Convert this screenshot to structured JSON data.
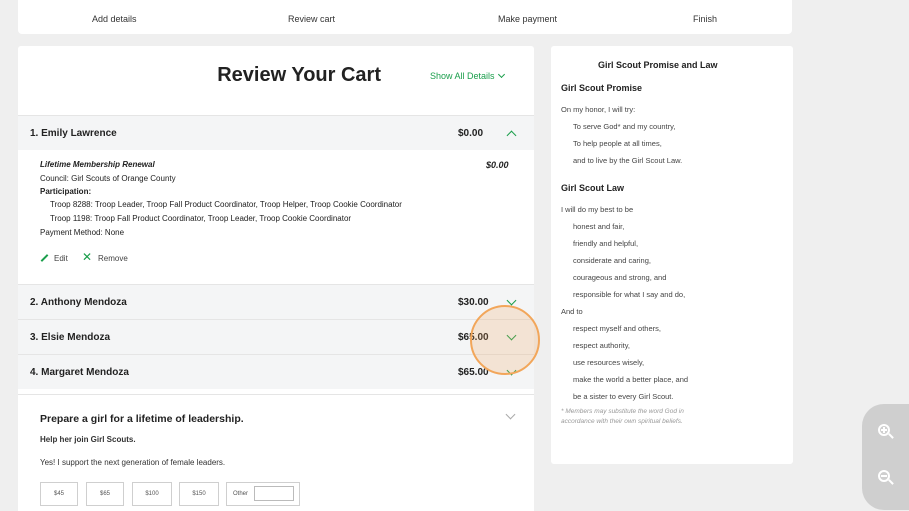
{
  "steps": [
    "Add details",
    "Review cart",
    "Make payment",
    "Finish"
  ],
  "cart": {
    "title": "Review Your Cart",
    "show_all": "Show All Details",
    "members": [
      {
        "name": "1. Emily Lawrence",
        "amount": "$0.00"
      },
      {
        "name": "2. Anthony Mendoza",
        "amount": "$30.00"
      },
      {
        "name": "3. Elsie Mendoza",
        "amount": "$65.00"
      },
      {
        "name": "4. Margaret Mendoza",
        "amount": "$65.00"
      }
    ],
    "detail": {
      "item": "Lifetime Membership Renewal",
      "item_amount": "$0.00",
      "council": "Council: Girl Scouts of Orange County",
      "participation_label": "Participation:",
      "troops": [
        "Troop 8288: Troop Leader, Troop Fall Product Coordinator, Troop Helper, Troop Cookie Coordinator",
        "Troop 1198: Troop Fall Product Coordinator, Troop Leader, Troop Cookie Coordinator"
      ],
      "payment_method": "Payment Method: None",
      "edit": "Edit",
      "remove": "Remove"
    },
    "donate": {
      "heading": "Prepare a girl for a lifetime of leadership.",
      "sub": "Help her join Girl Scouts.",
      "yes": "Yes! I support the next generation of female leaders.",
      "amounts": [
        "$45",
        "$65",
        "$100",
        "$150"
      ],
      "other": "Other"
    }
  },
  "promise": {
    "title": "Girl Scout Promise and Law",
    "promise_heading": "Girl Scout Promise",
    "promise_lines": [
      "On my honor, I will try:",
      "To serve God* and my country,",
      "To help people at all times,",
      "and to live by the Girl Scout Law."
    ],
    "law_heading": "Girl Scout Law",
    "law_lines": [
      "I will do my best to be",
      "honest and fair,",
      "friendly and helpful,",
      "considerate and caring,",
      "courageous and strong, and",
      "responsible for what I say and do,",
      "And to",
      "respect myself and others,",
      "respect authority,",
      "use resources wisely,",
      "make the world a better place, and",
      "be a sister to every Girl Scout."
    ],
    "note_lines": [
      "* Members may substitute the word God in",
      "accordance with their own spiritual beliefs."
    ]
  },
  "colors": {
    "accent": "#1a9e4b",
    "highlight": "#f2a65a"
  }
}
